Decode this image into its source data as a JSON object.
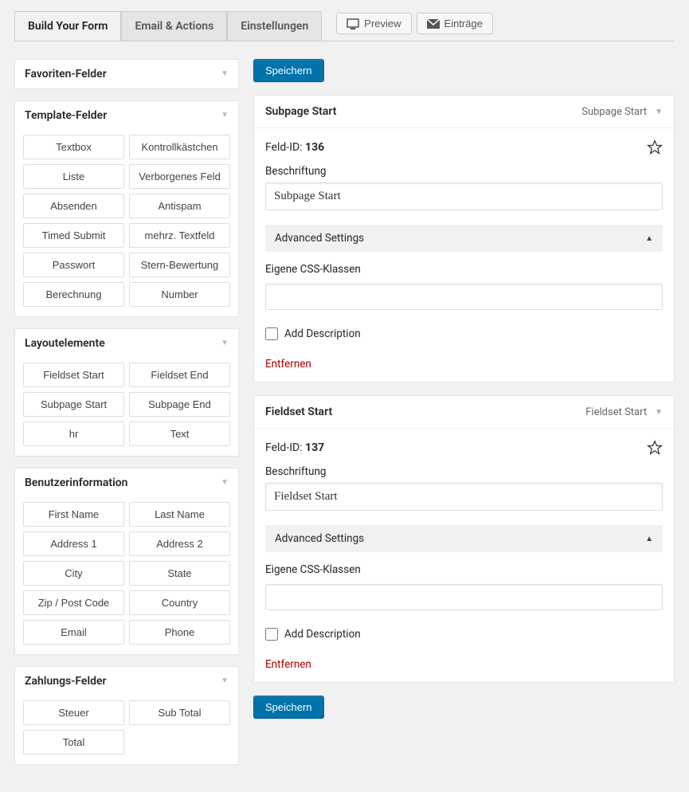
{
  "tabs": {
    "build": "Build Your Form",
    "email": "Email & Actions",
    "settings": "Einstellungen"
  },
  "topButtons": {
    "preview": "Preview",
    "entries": "Einträge"
  },
  "saveLabel": "Speichern",
  "sidebar": {
    "favorites": {
      "title": "Favoriten-Felder"
    },
    "template": {
      "title": "Template-Felder",
      "items": [
        "Textbox",
        "Kontrollkästchen",
        "Liste",
        "Verborgenes Feld",
        "Absenden",
        "Antispam",
        "Timed Submit",
        "mehrz. Textfeld",
        "Passwort",
        "Stern-Bewertung",
        "Berechnung",
        "Number"
      ]
    },
    "layout": {
      "title": "Layoutelemente",
      "items": [
        "Fieldset Start",
        "Fieldset End",
        "Subpage Start",
        "Subpage End",
        "hr",
        "Text"
      ]
    },
    "user": {
      "title": "Benutzerinformation",
      "items": [
        "First Name",
        "Last Name",
        "Address 1",
        "Address 2",
        "City",
        "State",
        "Zip / Post Code",
        "Country",
        "Email",
        "Phone"
      ]
    },
    "payment": {
      "title": "Zahlungs-Felder",
      "items": [
        "Steuer",
        "Sub Total",
        "Total"
      ]
    }
  },
  "fields": [
    {
      "title": "Subpage Start",
      "typeLabel": "Subpage Start",
      "idLabel": "Feld-ID:",
      "id": "136",
      "labelCaption": "Beschriftung",
      "labelValue": "Subpage Start",
      "advanced": "Advanced Settings",
      "cssLabel": "Eigene CSS-Klassen",
      "cssValue": "",
      "addDesc": "Add Description",
      "remove": "Entfernen"
    },
    {
      "title": "Fieldset Start",
      "typeLabel": "Fieldset Start",
      "idLabel": "Feld-ID:",
      "id": "137",
      "labelCaption": "Beschriftung",
      "labelValue": "Fieldset Start",
      "advanced": "Advanced Settings",
      "cssLabel": "Eigene CSS-Klassen",
      "cssValue": "",
      "addDesc": "Add Description",
      "remove": "Entfernen"
    }
  ]
}
